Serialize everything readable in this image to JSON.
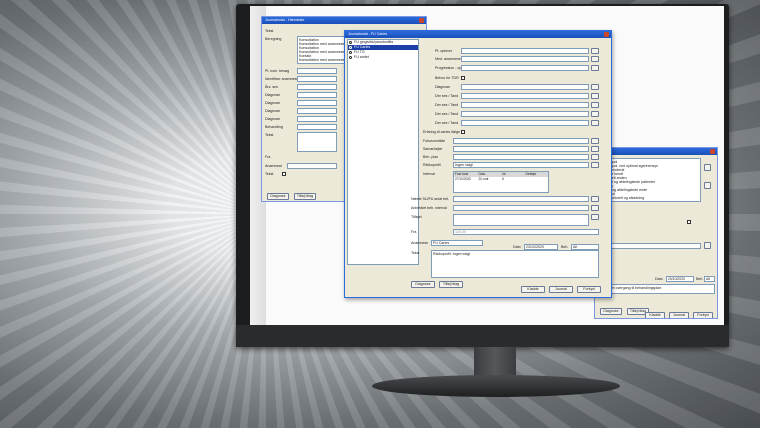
{
  "back_window": {
    "title": "Journalnotat - Hændelse",
    "field_labels": [
      "Tekst",
      "Beregning",
      "Pt. kom. besøg",
      "Identificer anamnese",
      "Års. ses",
      "Diagnose",
      "Diagnose",
      "Diagnose",
      "Diagnose",
      "Behandling",
      "Tekst",
      "Fra",
      "Anamnese",
      "Tekst"
    ],
    "list_items": [
      "Konsultation",
      "Konsultation med anamnese",
      "Konsultation",
      "Konsultation med anamnese",
      "Kontakt",
      "Konsultation med anamnese"
    ],
    "buttons": {
      "diagnose": "Diagnose",
      "tilfoej_bilag": "Tilføj bilag"
    }
  },
  "front_window": {
    "title": "Journalnotat - FU Caries",
    "tree": [
      {
        "label": "FU gingivitis/parodontitis",
        "selected": false
      },
      {
        "label": "FU Caries",
        "selected": true
      },
      {
        "label": "FU TG",
        "selected": false
      },
      {
        "label": "FU andet",
        "selected": false
      }
    ],
    "labels": {
      "pt_oplever": "Pt. oplever",
      "med_anamnese": "Med. anamnese",
      "progression": "Progression - opgaver",
      "behov_tdr": "Behov for TDR",
      "diagnose": "Diagnose",
      "der_ses_1": "Der ses / Tand",
      "der_ses_2": "Der ses / Tand",
      "der_ses_3": "Der ses / Tand",
      "der_ses_4": "Der ses / Tand",
      "erfaring": "Erfaring af caries ifølge",
      "fokusomraade": "Fokusområde",
      "samarbejde": "Samarbejde",
      "behandling": "Beh. plan",
      "risikoprofil": "Risikoprofil",
      "interval": "Interval",
      "naeste": "Næste SU/FU antal bet.",
      "anbefalet": "Anbefalet beh. interval",
      "tilfoeld": "Tilføjet",
      "fra": "Fra",
      "anamnese": "Anamnese",
      "tekst": "Tekst"
    },
    "values": {
      "risikoprofil": "Ingen valgt",
      "fra": "120.00",
      "anamnese": "FU Caries",
      "tekst": "Risikoprofil: Ingen valgt",
      "dato": "23/10/2020",
      "beh": "Alt"
    },
    "grid": {
      "headers": [
        "Fast tand",
        "Dato",
        "Int",
        "Detaljer"
      ],
      "row": [
        "27/10/2020",
        "20-mdr",
        "6",
        ""
      ]
    },
    "dato_label": "Dato",
    "beh_label": "Beh.",
    "buttons": {
      "diagnose": "Diagnose",
      "tilfoej_bilag": "Tilføj bilag",
      "klaedde": "Kladde",
      "journal": "Journal",
      "fortryd": "Fortryd"
    }
  },
  "right_window": {
    "lines": [
      "er god",
      "er god, ved optimal egenhensyn",
      "er moderat",
      "ikke kendt",
      "ideelt anden",
      "god og afdelingslede patienter",
      "ting",
      "de og afdelingslede ende",
      "kend",
      "strukturelt og afslutning"
    ],
    "dato_label": "Dato",
    "dato": "20/10/2020",
    "beh_label": "Beh.",
    "beh": "Alt",
    "footer_text": "givet overgang til behandlingsplan",
    "buttons": {
      "diagnose": "Diagnose",
      "tilfoej_bilag": "Tilføj bilag",
      "klaedde": "Kladde",
      "journal": "Journal",
      "fortryd": "Fortryd"
    }
  }
}
